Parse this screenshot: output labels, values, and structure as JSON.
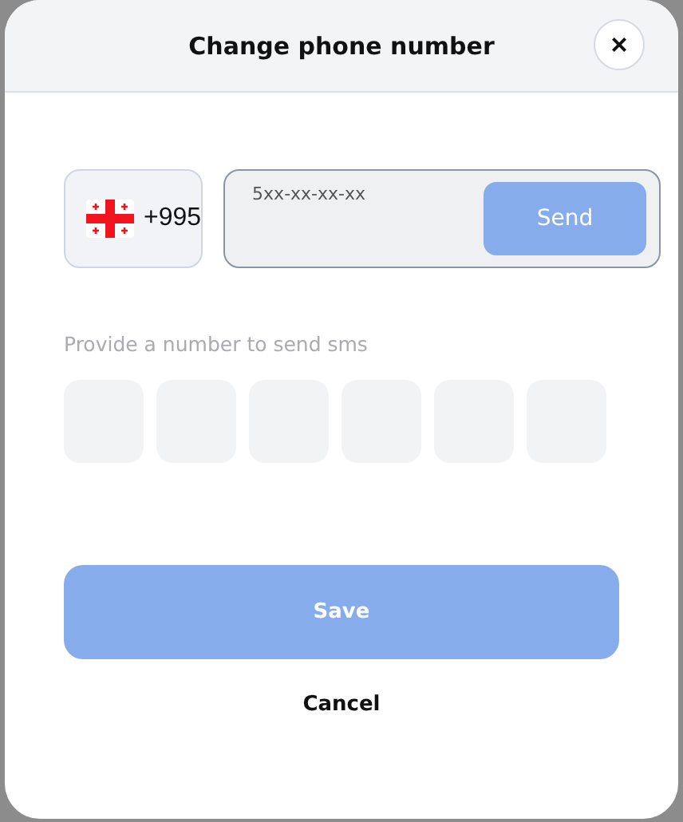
{
  "dialog": {
    "title": "Change phone number",
    "close_label": "×"
  },
  "country": {
    "kind": "georgia",
    "code": "+995"
  },
  "phone": {
    "placeholder": "5xx-xx-xx-xx",
    "send": {
      "label": "Send",
      "disabled": true
    }
  },
  "hint": "Provide a number to send sms",
  "code_boxes": [
    {
      "filled": false
    },
    {
      "filled": false
    },
    {
      "filled": false
    },
    {
      "filled": false
    },
    {
      "filled": false
    },
    {
      "filled": false
    }
  ],
  "save": {
    "label": "Save",
    "disabled": true
  },
  "cancel": {
    "label": "Cancel"
  }
}
